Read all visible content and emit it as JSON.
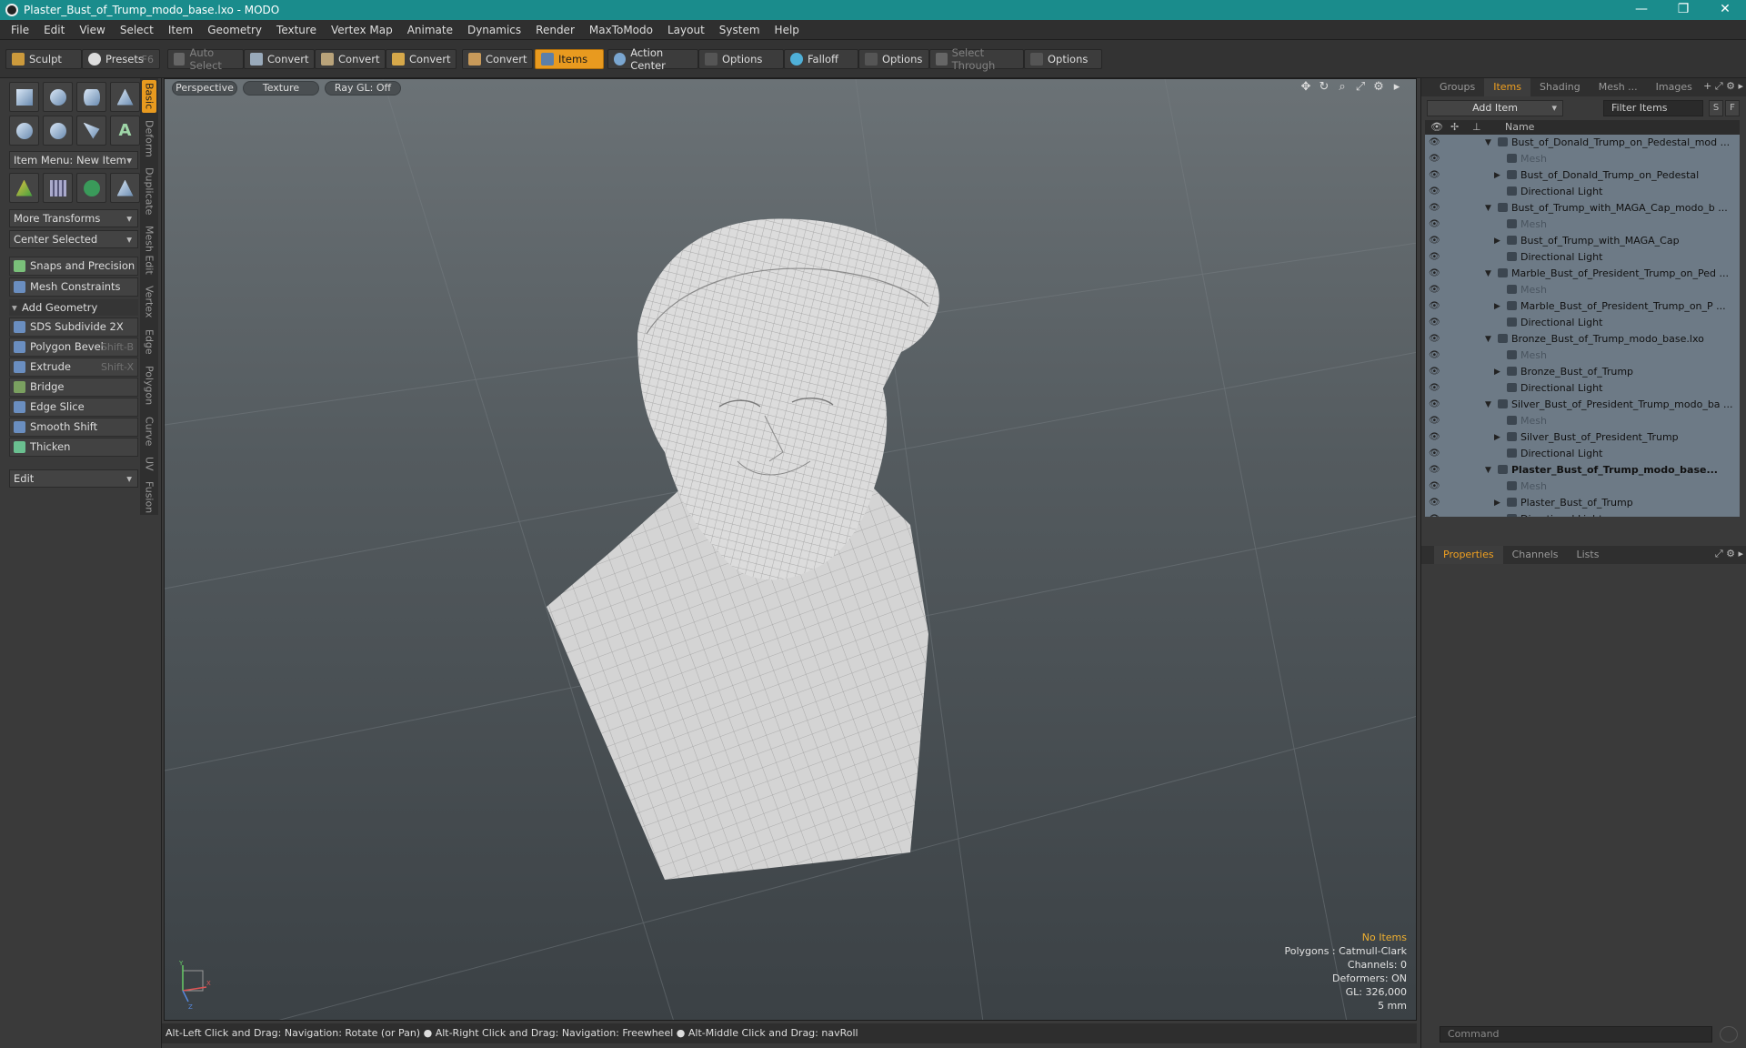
{
  "window": {
    "title": "Plaster_Bust_of_Trump_modo_base.lxo - MODO",
    "min": "—",
    "max": "❐",
    "close": "✕"
  },
  "menu": [
    "File",
    "Edit",
    "View",
    "Select",
    "Item",
    "Geometry",
    "Texture",
    "Vertex Map",
    "Animate",
    "Dynamics",
    "Render",
    "MaxToModo",
    "Layout",
    "System",
    "Help"
  ],
  "toolbar": {
    "sculpt": "Sculpt",
    "presets": "Presets",
    "presets_hint": "F6",
    "auto_select": "Auto Select",
    "convert1": "Convert",
    "convert2": "Convert",
    "convert3": "Convert",
    "convert4": "Convert",
    "items": "Items",
    "action_center": "Action Center",
    "options1": "Options",
    "falloff": "Falloff",
    "options2": "Options",
    "select_through": "Select Through",
    "options3": "Options"
  },
  "left": {
    "item_menu": "Item Menu: New Item",
    "more_transforms": "More Transforms",
    "center_selected": "Center Selected",
    "snaps": "Snaps and Precision",
    "mesh_constraints": "Mesh Constraints",
    "add_geometry": "Add Geometry",
    "tools": [
      {
        "label": "SDS Subdivide 2X",
        "hint": ""
      },
      {
        "label": "Polygon Bevel",
        "hint": "Shift-B"
      },
      {
        "label": "Extrude",
        "hint": "Shift-X"
      },
      {
        "label": "Bridge",
        "hint": ""
      },
      {
        "label": "Edge Slice",
        "hint": ""
      },
      {
        "label": "Smooth Shift",
        "hint": ""
      },
      {
        "label": "Thicken",
        "hint": ""
      }
    ],
    "edit": "Edit"
  },
  "vtabs": [
    "Basic",
    "Deform",
    "Duplicate",
    "Mesh Edit",
    "Vertex",
    "Edge",
    "Polygon",
    "Curve",
    "UV",
    "Fusion"
  ],
  "viewport": {
    "perspective": "Perspective",
    "texture": "Texture",
    "raygl": "Ray GL: Off",
    "info": {
      "no_items": "No Items",
      "polygons": "Polygons : Catmull-Clark",
      "channels": "Channels: 0",
      "deformers": "Deformers: ON",
      "gl": "GL: 326,000",
      "scale": "5 mm"
    },
    "axis_y": "Y",
    "axis_x": "X",
    "axis_z": "Z"
  },
  "status": "Alt-Left Click and Drag: Navigation: Rotate (or Pan) ● Alt-Right Click and Drag: Navigation: Freewheel ● Alt-Middle Click and Drag: navRoll",
  "right": {
    "tabs": [
      "Groups",
      "Items",
      "Shading",
      "Mesh ...",
      "Images"
    ],
    "add_item": "Add Item",
    "filter_items": "Filter Items",
    "s_btn": "S",
    "f_btn": "F",
    "name_col": "Name",
    "tree": [
      {
        "name": "Bust_of_Donald_Trump_on_Pedestal_mod ...",
        "level": 0,
        "kind": "scene"
      },
      {
        "name": "Mesh",
        "level": 1,
        "kind": "mesh"
      },
      {
        "name": "Bust_of_Donald_Trump_on_Pedestal",
        "level": 1,
        "kind": "group"
      },
      {
        "name": "Directional Light",
        "level": 1,
        "kind": "light"
      },
      {
        "name": "Bust_of_Trump_with_MAGA_Cap_modo_b ...",
        "level": 0,
        "kind": "scene"
      },
      {
        "name": "Mesh",
        "level": 1,
        "kind": "mesh"
      },
      {
        "name": "Bust_of_Trump_with_MAGA_Cap",
        "level": 1,
        "kind": "group"
      },
      {
        "name": "Directional Light",
        "level": 1,
        "kind": "light"
      },
      {
        "name": "Marble_Bust_of_President_Trump_on_Ped ...",
        "level": 0,
        "kind": "scene"
      },
      {
        "name": "Mesh",
        "level": 1,
        "kind": "mesh"
      },
      {
        "name": "Marble_Bust_of_President_Trump_on_P ...",
        "level": 1,
        "kind": "group"
      },
      {
        "name": "Directional Light",
        "level": 1,
        "kind": "light"
      },
      {
        "name": "Bronze_Bust_of_Trump_modo_base.lxo",
        "level": 0,
        "kind": "scene"
      },
      {
        "name": "Mesh",
        "level": 1,
        "kind": "mesh"
      },
      {
        "name": "Bronze_Bust_of_Trump",
        "level": 1,
        "kind": "group"
      },
      {
        "name": "Directional Light",
        "level": 1,
        "kind": "light"
      },
      {
        "name": "Silver_Bust_of_President_Trump_modo_ba ...",
        "level": 0,
        "kind": "scene"
      },
      {
        "name": "Mesh",
        "level": 1,
        "kind": "mesh"
      },
      {
        "name": "Silver_Bust_of_President_Trump",
        "level": 1,
        "kind": "group"
      },
      {
        "name": "Directional Light",
        "level": 1,
        "kind": "light"
      },
      {
        "name": "Plaster_Bust_of_Trump_modo_base...",
        "level": 0,
        "kind": "scene",
        "bold": true
      },
      {
        "name": "Mesh",
        "level": 1,
        "kind": "mesh"
      },
      {
        "name": "Plaster_Bust_of_Trump",
        "level": 1,
        "kind": "group"
      },
      {
        "name": "Directional Light",
        "level": 1,
        "kind": "light"
      }
    ],
    "props_tabs": [
      "Properties",
      "Channels",
      "Lists"
    ],
    "command_placeholder": "Command"
  }
}
